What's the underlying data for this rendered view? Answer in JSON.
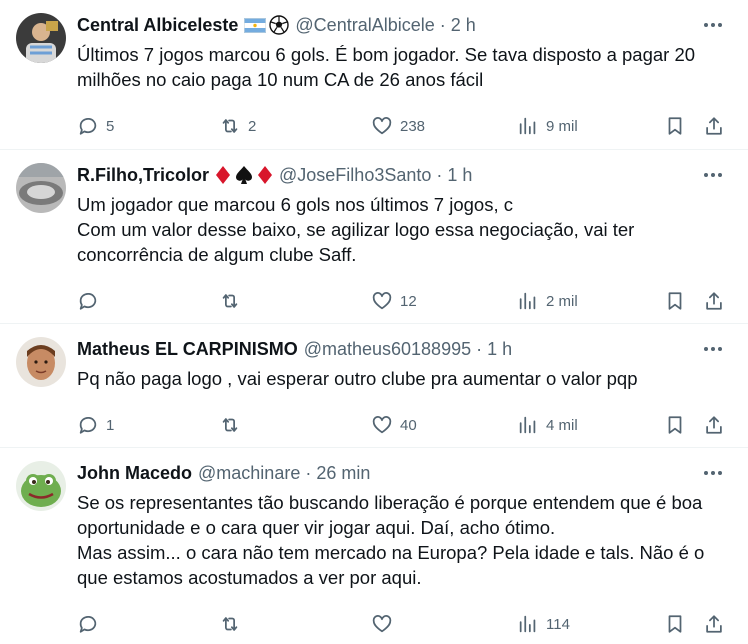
{
  "tweets": [
    {
      "name": "Central Albiceleste",
      "emoji": [
        "argentina-flag",
        "soccer-ball"
      ],
      "handle": "@CentralAlbicele",
      "sep": "·",
      "time": "2 h",
      "text": "Últimos 7 jogos marcou 6 gols. É bom jogador. Se tava disposto a pagar 20 milhões no caio paga 10 num CA de 26 anos fácil",
      "replies": "5",
      "retweets": "2",
      "likes": "238",
      "views": "9 mil"
    },
    {
      "name": "R.Filho,Tricolor",
      "emoji": [
        "red-diamond",
        "black-spade",
        "red-diamond"
      ],
      "handle": "@JoseFilho3Santo",
      "sep": "·",
      "time": "1 h",
      "text": "Um jogador que marcou 6 gols nos últimos 7 jogos, c\nCom um valor desse baixo,  se agilizar logo essa negociação,  vai ter concorrência de algum clube Saff.",
      "replies": "",
      "retweets": "",
      "likes": "12",
      "views": "2 mil"
    },
    {
      "name": "Matheus EL CARPINISMO",
      "emoji": [],
      "handle": "@matheus60188995",
      "sep": "·",
      "time": "1 h",
      "text": "Pq não paga logo , vai esperar outro clube pra aumentar o valor pqp",
      "replies": "1",
      "retweets": "",
      "likes": "40",
      "views": "4 mil"
    },
    {
      "name": "John Macedo",
      "emoji": [],
      "handle": "@machinare",
      "sep": "·",
      "time": "26 min",
      "text": "Se os representantes tão buscando liberação é porque entendem que é boa oportunidade e o cara quer vir jogar aqui. Daí, acho ótimo.\nMas assim... o cara não tem mercado na Europa? Pela idade e tals. Não é o que estamos acostumados a ver por aqui.",
      "replies": "",
      "retweets": "",
      "likes": "",
      "views": "114"
    }
  ],
  "colors": {
    "text": "#0f1419",
    "secondary": "#536471",
    "divider": "#eff3f4",
    "diamond": "#d8162b"
  },
  "icons": [
    "more-icon",
    "reply-icon",
    "retweet-icon",
    "like-icon",
    "views-icon",
    "bookmark-icon",
    "share-icon"
  ]
}
